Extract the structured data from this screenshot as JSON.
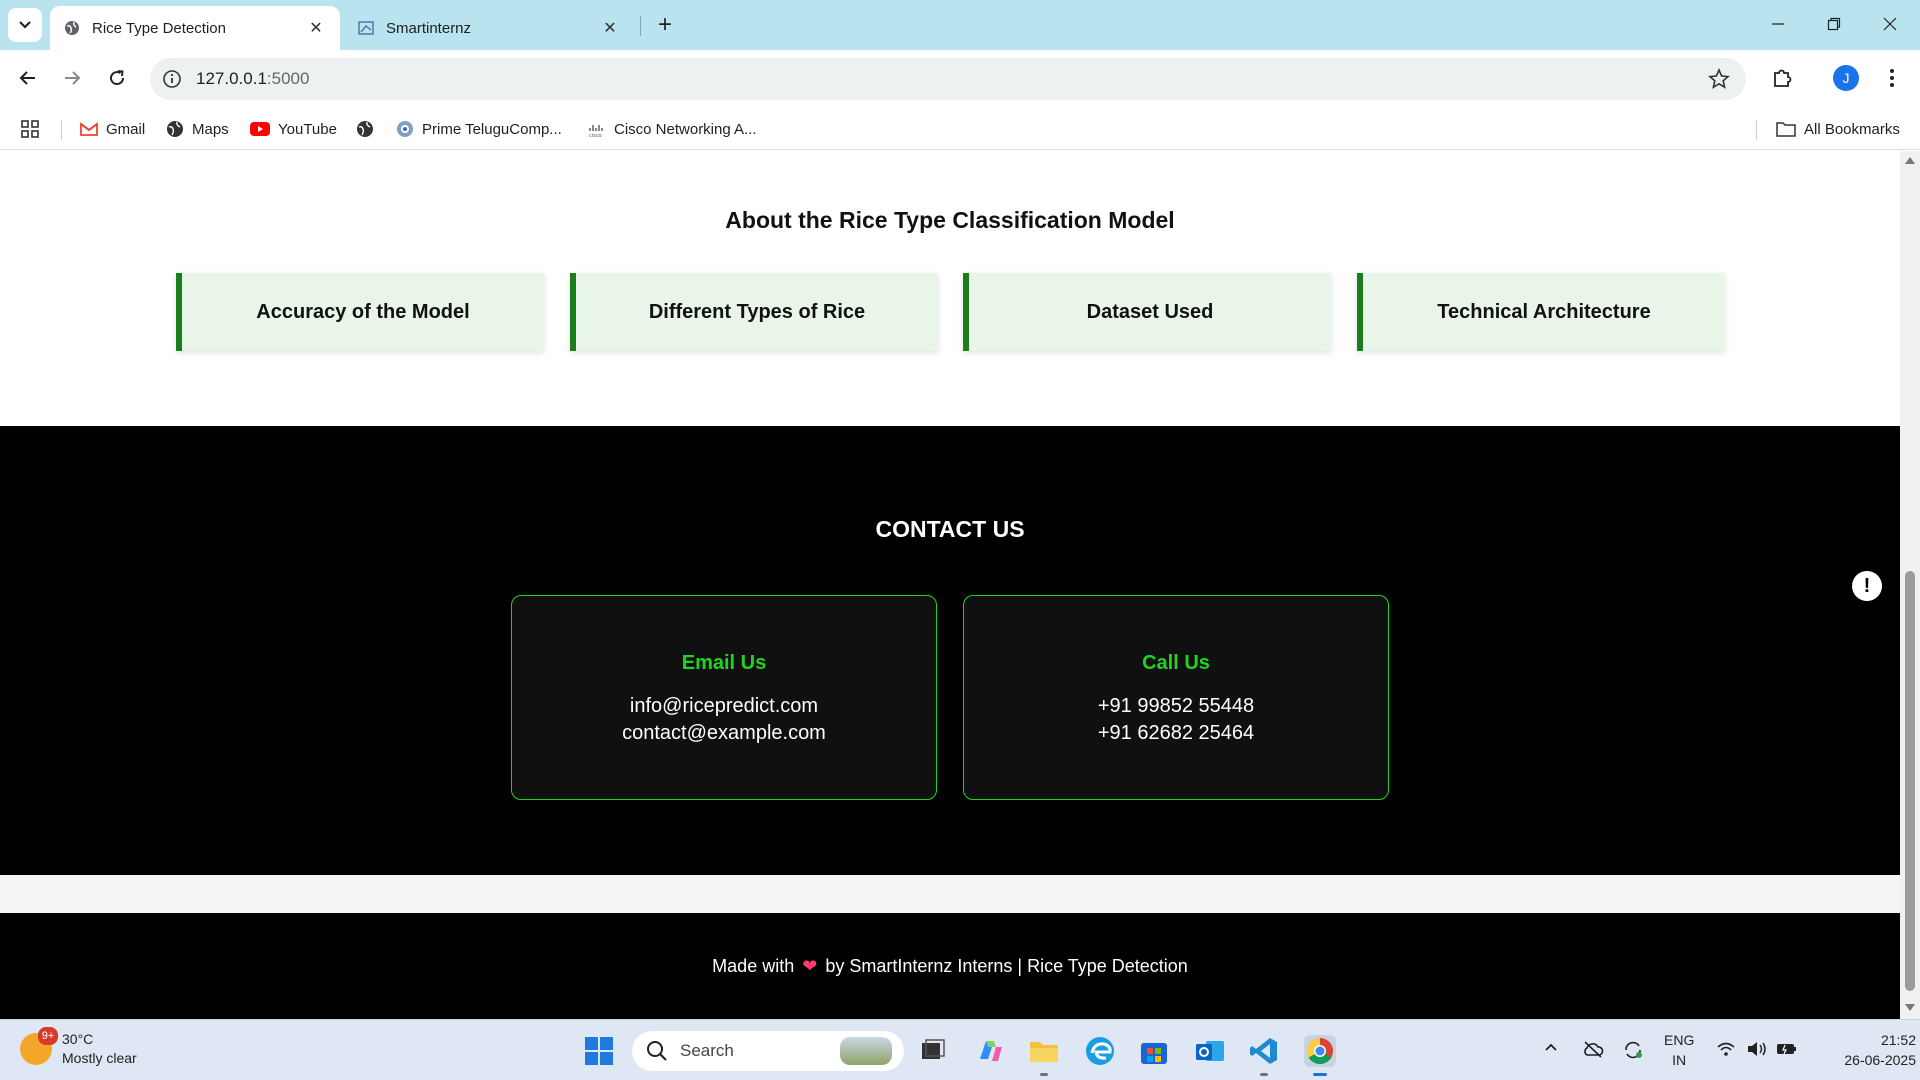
{
  "browser": {
    "tabs": [
      {
        "title": "Rice Type Detection",
        "active": true
      },
      {
        "title": "Smartinternz",
        "active": false
      }
    ],
    "url": {
      "host": "127.0.0.1",
      "port": ":5000"
    },
    "profile_initial": "J",
    "bookmarks": [
      "Gmail",
      "Maps",
      "YouTube",
      "Prime TeluguComp...",
      "Cisco Networking A..."
    ],
    "all_bookmarks": "All Bookmarks"
  },
  "about": {
    "title": "About the Rice Type Classification Model",
    "cards": [
      "Accuracy of the Model",
      "Different Types of Rice",
      "Dataset Used",
      "Technical Architecture"
    ]
  },
  "contact": {
    "title": "CONTACT US",
    "email": {
      "heading": "Email Us",
      "lines": [
        "info@ricepredict.com",
        "contact@example.com"
      ]
    },
    "call": {
      "heading": "Call Us",
      "lines": [
        "+91 99852 55448",
        "+91 62682 25464"
      ]
    }
  },
  "footer": {
    "prefix": "Made with",
    "suffix": "by SmartInternz Interns | Rice Type Detection"
  },
  "chat_bubble": "!",
  "taskbar": {
    "weather_badge": "9+",
    "temperature": "30°C",
    "condition": "Mostly clear",
    "search_placeholder": "Search",
    "lang_line1": "ENG",
    "lang_line2": "IN",
    "time": "21:52",
    "date": "26-06-2025"
  },
  "colors": {
    "accent_green": "#1ed41e",
    "card_bg": "#e9f5e9",
    "card_border": "#1a7f1a",
    "tabbar": "#b8e3ef"
  }
}
